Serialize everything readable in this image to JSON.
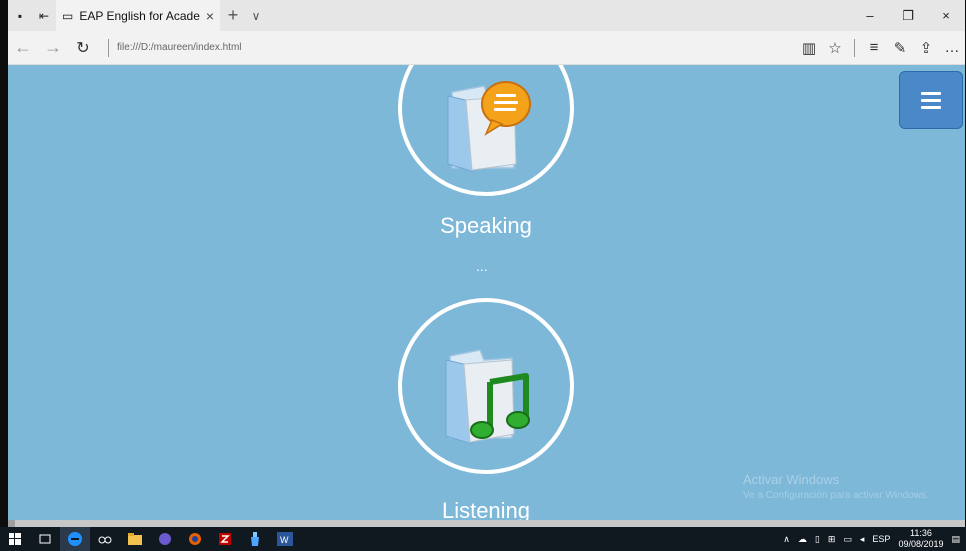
{
  "browser": {
    "tab_title": "EAP English for Academ",
    "tab_close": "×",
    "new_tab": "+",
    "tab_menu": "∨",
    "window_controls": {
      "minimize": "–",
      "restore": "❐",
      "close": "×"
    },
    "nav": {
      "back": "←",
      "forward": "→",
      "refresh": "↻"
    },
    "url": "file:///D:/maureen/index.html",
    "tools": {
      "reading_view": "▥",
      "favorite": "☆",
      "hub": "≡",
      "notes": "✎",
      "share": "⇪",
      "more": "…"
    }
  },
  "page": {
    "sections": [
      {
        "label": "Speaking",
        "icon": "speech-bubble-folder-icon"
      },
      {
        "label": "Listening",
        "icon": "music-note-folder-icon"
      }
    ],
    "separator": "...",
    "watermark": {
      "line1": "Activar Windows",
      "line2": "Ve a Configuración para activar Windows."
    }
  },
  "taskbar": {
    "language": "ESP",
    "time": "11:36",
    "date": "09/08/2019"
  },
  "colors": {
    "page_background": "#7db8d9",
    "menu_button": "#4a88c7",
    "taskbar": "#101820"
  }
}
